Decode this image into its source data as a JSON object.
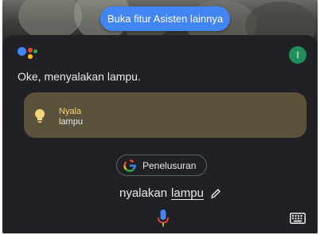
{
  "top_chip": {
    "label": "Buka fitur Asisten lainnya"
  },
  "avatar": {
    "initial": "I",
    "color": "#1e8e5a"
  },
  "response": {
    "text": "Oke, menyalakan lampu."
  },
  "device_card": {
    "status": "Nyala",
    "name": "lampu",
    "icon": "lightbulb-icon",
    "color": "#5b523b"
  },
  "search_chip": {
    "label": "Penelusuran",
    "icon": "google-g-icon"
  },
  "query": {
    "prefix": "nyalakan",
    "highlight": "lampu",
    "edit_icon": "pencil-icon"
  },
  "input": {
    "mic_icon": "mic-icon",
    "keyboard_icon": "keyboard-icon"
  },
  "colors": {
    "accent": "#4285f4",
    "sheet": "#202124"
  }
}
